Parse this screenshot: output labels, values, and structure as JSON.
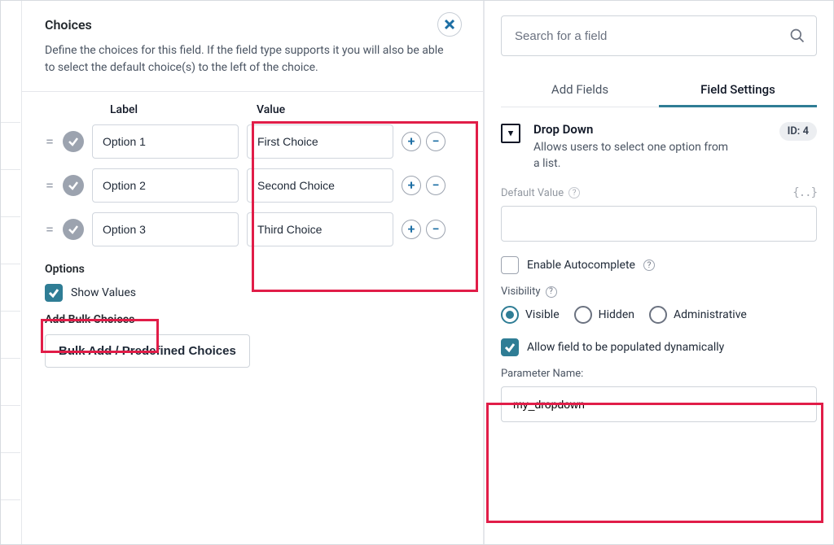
{
  "left": {
    "title": "Choices",
    "description": "Define the choices for this field. If the field type supports it you will also be able to select the default choice(s) to the left of the choice.",
    "headers": {
      "label": "Label",
      "value": "Value"
    },
    "rows": [
      {
        "label": "Option 1",
        "value": "First Choice"
      },
      {
        "label": "Option 2",
        "value": "Second Choice"
      },
      {
        "label": "Option 3",
        "value": "Third Choice"
      }
    ],
    "options_title": "Options",
    "show_values_label": "Show Values",
    "bulk_title": "Add Bulk Choices",
    "bulk_button": "Bulk Add / Predefined Choices"
  },
  "right": {
    "search_placeholder": "Search for a field",
    "tabs": {
      "add": "Add Fields",
      "settings": "Field Settings"
    },
    "field": {
      "title": "Drop Down",
      "description": "Allows users to select one option from a list.",
      "id_badge": "ID: 4"
    },
    "default_value_label": "Default Value",
    "default_value": "",
    "enable_autocomplete_label": "Enable Autocomplete",
    "visibility_label": "Visibility",
    "visibility_options": {
      "visible": "Visible",
      "hidden": "Hidden",
      "administrative": "Administrative"
    },
    "allow_dynamic_label": "Allow field to be populated dynamically",
    "parameter_name_label": "Parameter Name:",
    "parameter_name_value": "my_dropdown"
  }
}
